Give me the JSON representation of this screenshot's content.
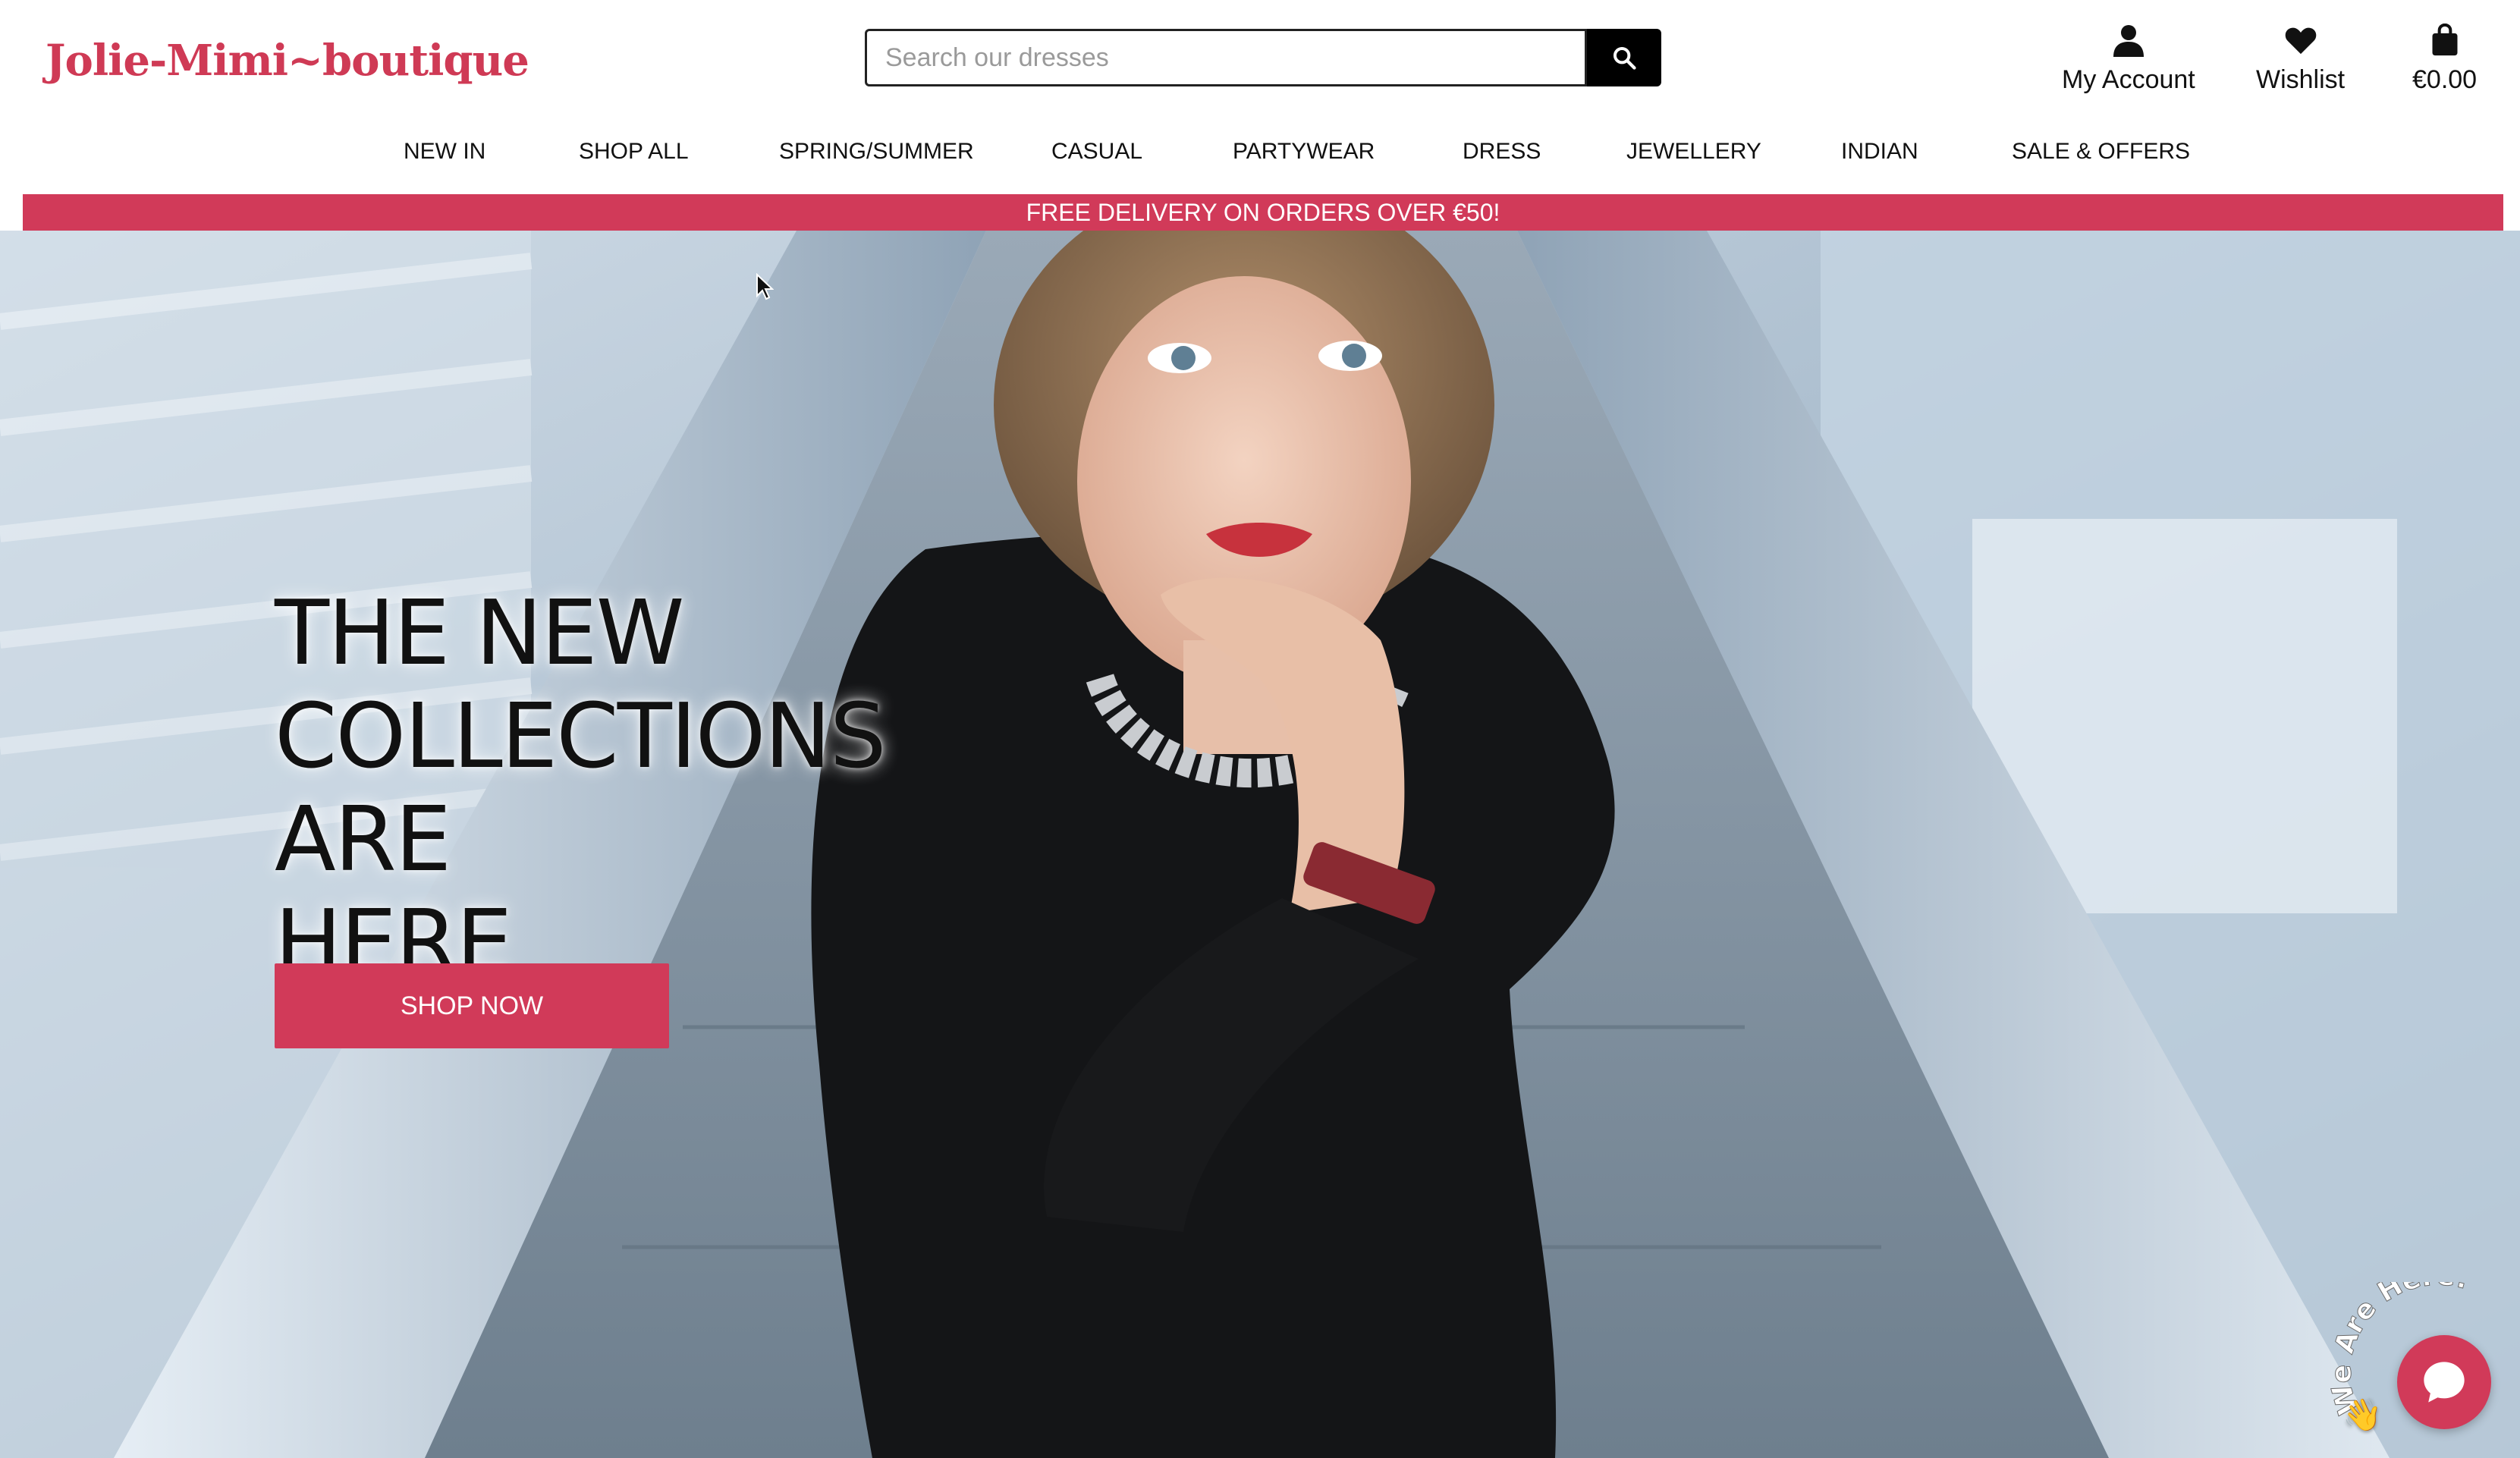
{
  "header": {
    "logo_text": "Jolie-Mimi~boutique",
    "search": {
      "placeholder": "Search our dresses",
      "value": ""
    },
    "actions": {
      "account_label": "My Account",
      "wishlist_label": "Wishlist",
      "cart_total": "€0.00"
    }
  },
  "nav": {
    "items": [
      {
        "label": "NEW IN"
      },
      {
        "label": "SHOP ALL"
      },
      {
        "label": "SPRING/SUMMER"
      },
      {
        "label": "CASUAL"
      },
      {
        "label": "PARTYWEAR"
      },
      {
        "label": "DRESS"
      },
      {
        "label": "JEWELLERY"
      },
      {
        "label": "INDIAN"
      },
      {
        "label": "SALE & OFFERS"
      }
    ]
  },
  "promo": {
    "text": "FREE DELIVERY ON ORDERS OVER €50!"
  },
  "hero": {
    "title_lines": [
      "THE NEW",
      "COLLECTIONS ARE",
      "HERE"
    ],
    "cta_label": "SHOP NOW"
  },
  "chat": {
    "badge_text": "We Are Here!",
    "wave_glyph": "👋"
  },
  "colors": {
    "brand": "#d13a59",
    "logo": "#cf3a55",
    "search_button": "#000000"
  },
  "icons": {
    "search": "search-icon",
    "account": "user-icon",
    "wishlist": "heart-icon",
    "cart": "shopping-bag-icon",
    "chat": "chat-bubble-icon"
  }
}
